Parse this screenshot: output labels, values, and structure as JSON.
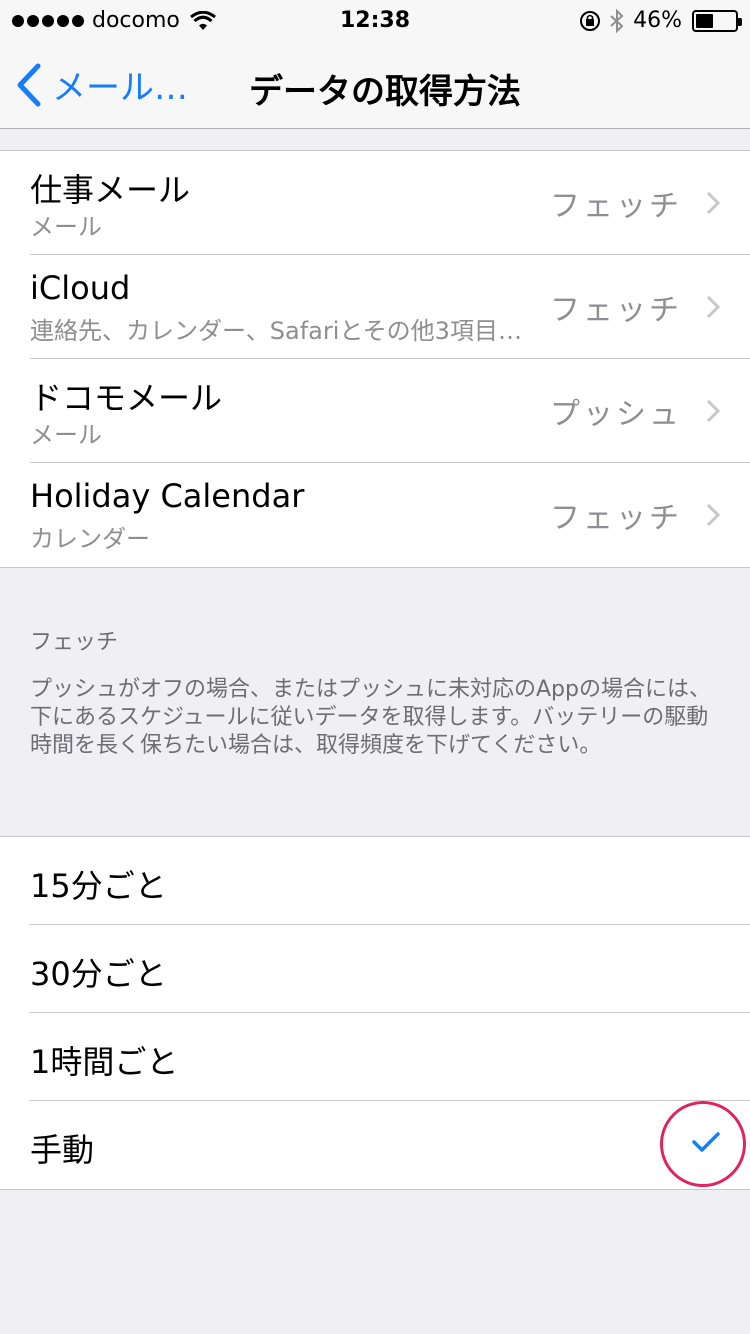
{
  "status_bar": {
    "carrier": "docomo",
    "time": "12:38",
    "battery": "46%",
    "battery_level": 0.46,
    "icons": [
      "signal-dots",
      "wifi-icon",
      "rotation-lock-icon",
      "bluetooth-icon",
      "battery-icon"
    ]
  },
  "nav": {
    "back_label": "メール…",
    "title": "データの取得方法"
  },
  "accounts": [
    {
      "name": "仕事メール",
      "sub": "メール",
      "value": "フェッチ"
    },
    {
      "name": "iCloud",
      "sub": "連絡先、カレンダー、Safariとその他3項目…",
      "value": "フェッチ"
    },
    {
      "name": "ドコモメール",
      "sub": "メール",
      "value": "プッシュ"
    },
    {
      "name": "Holiday Calendar",
      "sub": "カレンダー",
      "value": "フェッチ"
    }
  ],
  "fetch_section": {
    "header": "フェッチ",
    "description": "プッシュがオフの場合、またはプッシュに未対応のAppの場合には、下にあるスケジュールに従いデータを取得します。バッテリーの駆動時間を長く保ちたい場合は、取得頻度を下げてください。"
  },
  "options": [
    {
      "label": "15分ごと",
      "selected": false
    },
    {
      "label": "30分ごと",
      "selected": false
    },
    {
      "label": "1時間ごと",
      "selected": false
    },
    {
      "label": "手動",
      "selected": true
    }
  ],
  "colors": {
    "accent": "#157efb",
    "secondary_text": "#8e8e93",
    "background": "#efeff4",
    "highlight_circle": "#e0245e"
  }
}
